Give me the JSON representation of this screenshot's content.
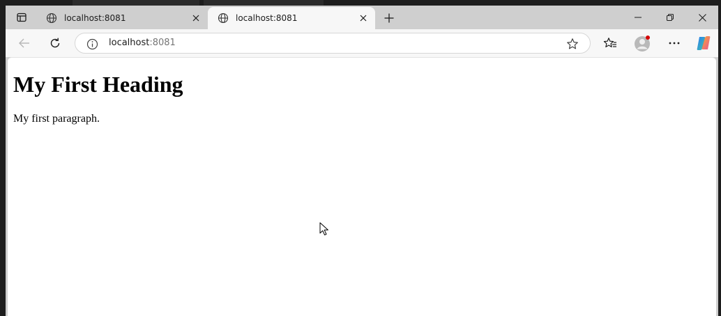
{
  "browser": {
    "tabs": [
      {
        "title": "localhost:8081",
        "active": false,
        "icon": "globe-icon"
      },
      {
        "title": "localhost:8081",
        "active": true,
        "icon": "globe-icon"
      }
    ],
    "new_tab_icon": "plus-icon",
    "window_controls": [
      "minimize-icon",
      "restore-icon",
      "close-icon"
    ]
  },
  "toolbar": {
    "back_icon": "back-arrow-icon",
    "reload_icon": "reload-icon",
    "address": {
      "host": "localhost",
      "port": ":8081",
      "info_icon": "info-icon",
      "favorite_icon": "star-icon"
    },
    "favorites_icon": "favorites-icon",
    "profile_icon": "profile-avatar",
    "more_icon": "more-icon",
    "copilot_icon": "copilot-icon"
  },
  "page": {
    "heading": "My First Heading",
    "paragraph": "My first paragraph."
  },
  "colors": {
    "tabstrip_bg": "#cfcfcf",
    "toolbar_bg": "#f7f7f7",
    "page_bg": "#ffffff",
    "profile_badge": "#d40000"
  }
}
